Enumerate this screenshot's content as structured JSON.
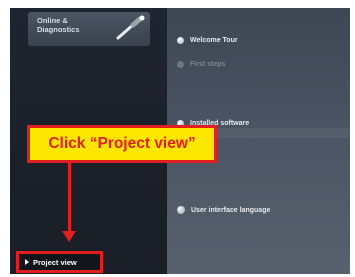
{
  "sidebar": {
    "online_diagnostics_label": "Online &\nDiagnostics",
    "project_view_label": "Project view"
  },
  "menu": {
    "items": [
      {
        "label": "Welcome Tour",
        "icon": "bullet-icon"
      },
      {
        "label": "First steps",
        "icon": "bullet-icon"
      },
      {
        "label": "Installed software",
        "icon": "bullet-icon"
      },
      {
        "label": "User interface language",
        "icon": "globe-icon"
      }
    ]
  },
  "annotation": {
    "callout_text": "Click “Project view”"
  },
  "colors": {
    "callout_background": "#fbe600",
    "annotation_red": "#e01f1f",
    "sidebar_dark": "#1b2029",
    "panel_gray": "#4a5462"
  }
}
